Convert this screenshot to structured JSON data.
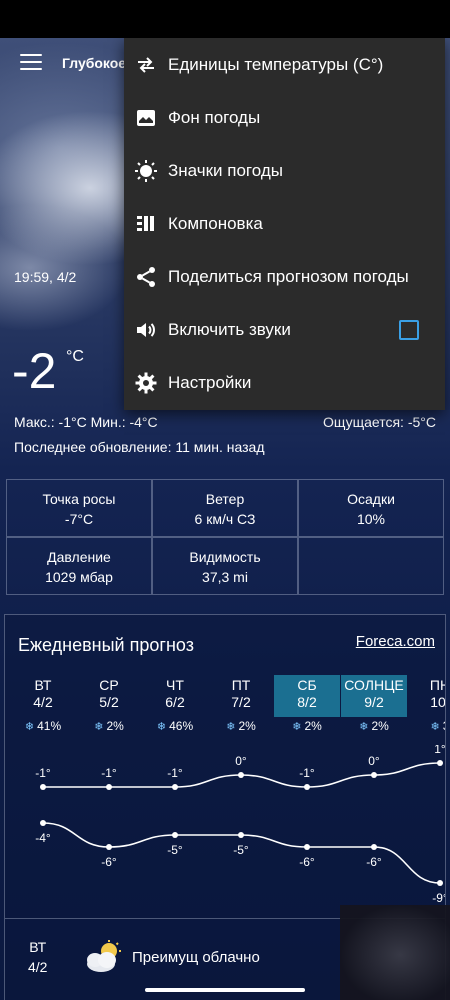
{
  "header": {
    "location": "Глубокое"
  },
  "current": {
    "datetime": "19:59, 4/2",
    "temperature": "-2",
    "unit": "°C",
    "maxmin": "Макс.: -1°C  Мин.: -4°C",
    "feels_like": "Ощущается: -5°C",
    "updated": "Последнее обновление: 11 мин. назад"
  },
  "details": [
    {
      "label": "Точка росы",
      "value": "-7°C"
    },
    {
      "label": "Ветер",
      "value": "6 км/ч СЗ"
    },
    {
      "label": "Осадки",
      "value": "10%"
    },
    {
      "label": "Давление",
      "value": "1029 мбар"
    },
    {
      "label": "Видимость",
      "value": "37,3 mi"
    }
  ],
  "daily": {
    "title": "Ежедневный прогноз",
    "provider_link": "Foreca.com",
    "days": [
      {
        "name": "ВТ",
        "date": "4/2",
        "precip": "41%",
        "max": "-1°",
        "min": "-4°",
        "highlighted": false
      },
      {
        "name": "СР",
        "date": "5/2",
        "precip": "2%",
        "max": "-1°",
        "min": "-6°",
        "highlighted": false
      },
      {
        "name": "ЧТ",
        "date": "6/2",
        "precip": "46%",
        "max": "-1°",
        "min": "-5°",
        "highlighted": false
      },
      {
        "name": "ПТ",
        "date": "7/2",
        "precip": "2%",
        "max": "0°",
        "min": "-5°",
        "highlighted": false
      },
      {
        "name": "СБ",
        "date": "8/2",
        "precip": "2%",
        "max": "-1°",
        "min": "-6°",
        "highlighted": true
      },
      {
        "name": "СОЛНЦЕ",
        "date": "9/2",
        "precip": "2%",
        "max": "0°",
        "min": "-6°",
        "highlighted": true
      },
      {
        "name": "ПН",
        "date": "10/",
        "precip": "3",
        "max": "1°",
        "min": "-9°",
        "highlighted": false
      }
    ],
    "row": {
      "day": "ВТ",
      "date": "4/2",
      "condition": "Преимущ облачно"
    }
  },
  "menu": {
    "items": [
      {
        "label": "Единицы температуры (C°)",
        "icon": "swap-arrows-icon"
      },
      {
        "label": "Фон погоды",
        "icon": "image-icon"
      },
      {
        "label": "Значки погоды",
        "icon": "sun-icon"
      },
      {
        "label": "Компоновка",
        "icon": "layout-icon"
      },
      {
        "label": "Поделиться прогнозом погоды",
        "icon": "share-icon"
      },
      {
        "label": "Включить звуки",
        "icon": "volume-icon",
        "checked": false
      },
      {
        "label": "Настройки",
        "icon": "gear-icon"
      }
    ]
  },
  "colors": {
    "accent": "#1b6f91",
    "checkbox": "#3aa0e6",
    "menu_bg": "#2b2b2b"
  }
}
